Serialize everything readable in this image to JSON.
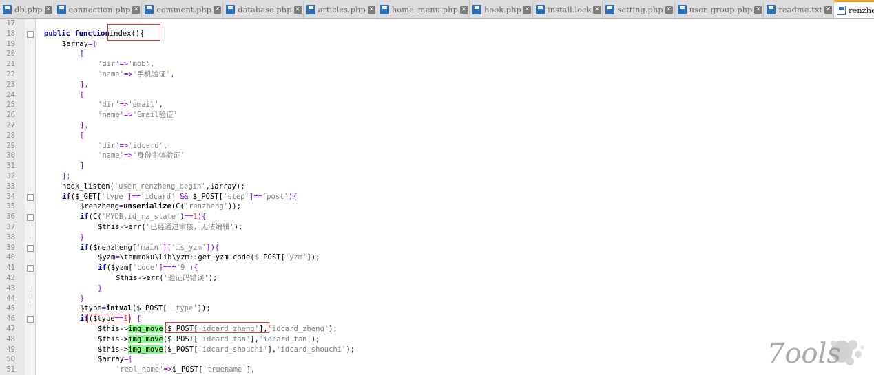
{
  "tabs": [
    {
      "label": "db.php",
      "active": false
    },
    {
      "label": "connection.php",
      "active": false
    },
    {
      "label": "comment.php",
      "active": false
    },
    {
      "label": "database.php",
      "active": false
    },
    {
      "label": "articles.php",
      "active": false
    },
    {
      "label": "home_menu.php",
      "active": false
    },
    {
      "label": "hook.php",
      "active": false
    },
    {
      "label": "install.lock",
      "active": false
    },
    {
      "label": "setting.php",
      "active": false
    },
    {
      "label": "user_group.php",
      "active": false
    },
    {
      "label": "readme.txt",
      "active": false
    },
    {
      "label": "renzheng.p",
      "active": true
    }
  ],
  "editor": {
    "lines": [
      {
        "num": "17",
        "fold": "",
        "indent": 0,
        "tokens": []
      },
      {
        "num": "18",
        "fold": "minus",
        "indent": 0,
        "tokens": [
          [
            "kw",
            "public function"
          ],
          [
            "",
            "index(){"
          ]
        ]
      },
      {
        "num": "19",
        "fold": "line",
        "indent": 1,
        "tokens": [
          [
            "",
            "$array"
          ],
          [
            "op",
            "=["
          ]
        ]
      },
      {
        "num": "20",
        "fold": "line",
        "indent": 2,
        "tokens": [
          [
            "op",
            "["
          ]
        ]
      },
      {
        "num": "21",
        "fold": "line",
        "indent": 3,
        "tokens": [
          [
            "str",
            "'dir'"
          ],
          [
            "op",
            "=>"
          ],
          [
            "str",
            "'mob'"
          ],
          [
            "op",
            ","
          ]
        ]
      },
      {
        "num": "22",
        "fold": "line",
        "indent": 3,
        "tokens": [
          [
            "str",
            "'name'"
          ],
          [
            "op",
            "=>"
          ],
          [
            "str",
            "'手机验证'"
          ],
          [
            "op",
            ","
          ]
        ]
      },
      {
        "num": "23",
        "fold": "line",
        "indent": 2,
        "tokens": [
          [
            "op",
            "],"
          ]
        ]
      },
      {
        "num": "24",
        "fold": "line",
        "indent": 2,
        "tokens": [
          [
            "op",
            "["
          ]
        ]
      },
      {
        "num": "25",
        "fold": "line",
        "indent": 3,
        "tokens": [
          [
            "str",
            "'dir'"
          ],
          [
            "op",
            "=>"
          ],
          [
            "str",
            "'email'"
          ],
          [
            "op",
            ","
          ]
        ]
      },
      {
        "num": "26",
        "fold": "line",
        "indent": 3,
        "tokens": [
          [
            "str",
            "'name'"
          ],
          [
            "op",
            "=>"
          ],
          [
            "str",
            "'Email验证'"
          ]
        ]
      },
      {
        "num": "27",
        "fold": "line",
        "indent": 2,
        "tokens": [
          [
            "op",
            "],"
          ]
        ]
      },
      {
        "num": "28",
        "fold": "line",
        "indent": 2,
        "tokens": [
          [
            "op",
            "["
          ]
        ]
      },
      {
        "num": "29",
        "fold": "line",
        "indent": 3,
        "tokens": [
          [
            "str",
            "'dir'"
          ],
          [
            "op",
            "=>"
          ],
          [
            "str",
            "'idcard'"
          ],
          [
            "op",
            ","
          ]
        ]
      },
      {
        "num": "30",
        "fold": "line",
        "indent": 3,
        "tokens": [
          [
            "str",
            "'name'"
          ],
          [
            "op",
            "=>"
          ],
          [
            "str",
            "'身份主体验证'"
          ]
        ]
      },
      {
        "num": "31",
        "fold": "line",
        "indent": 2,
        "tokens": [
          [
            "op",
            "]"
          ]
        ]
      },
      {
        "num": "32",
        "fold": "line",
        "indent": 1,
        "tokens": [
          [
            "op",
            "];"
          ]
        ]
      },
      {
        "num": "33",
        "fold": "line",
        "indent": 1,
        "tokens": [
          [
            "",
            "hook_listen("
          ],
          [
            "str",
            "'user_renzheng_begin'"
          ],
          [
            "",
            ",$array);"
          ]
        ]
      },
      {
        "num": "34",
        "fold": "minus",
        "indent": 1,
        "tokens": [
          [
            "kw",
            "if"
          ],
          [
            "",
            "($_GET["
          ],
          [
            "str",
            "'type'"
          ],
          [
            "op",
            "]=="
          ],
          [
            "str",
            "'idcard'"
          ],
          [
            "op",
            " && "
          ],
          [
            "",
            "$_POST["
          ],
          [
            "str",
            "'step'"
          ],
          [
            "op",
            "]=="
          ],
          [
            "str",
            "'post'"
          ],
          [
            "op",
            "){"
          ]
        ]
      },
      {
        "num": "35",
        "fold": "line",
        "indent": 2,
        "tokens": [
          [
            "",
            "$renzheng"
          ],
          [
            "op",
            "="
          ],
          [
            "fn",
            "unserialize"
          ],
          [
            "",
            "(C("
          ],
          [
            "str",
            "'renzheng'"
          ],
          [
            "",
            "));"
          ]
        ]
      },
      {
        "num": "36",
        "fold": "minus",
        "indent": 2,
        "tokens": [
          [
            "kw",
            "if"
          ],
          [
            "",
            "(C("
          ],
          [
            "str",
            "'MYDB.id_rz_state'"
          ],
          [
            "",
            ")"
          ],
          [
            "op",
            "=="
          ],
          [
            "num",
            "1"
          ],
          [
            "op",
            "){"
          ]
        ]
      },
      {
        "num": "37",
        "fold": "line",
        "indent": 3,
        "tokens": [
          [
            "",
            "$this->err("
          ],
          [
            "str",
            "'已经通过审核，无法编辑'"
          ],
          [
            "",
            ");"
          ]
        ]
      },
      {
        "num": "38",
        "fold": "end",
        "indent": 2,
        "tokens": [
          [
            "op",
            "}"
          ]
        ]
      },
      {
        "num": "39",
        "fold": "minus",
        "indent": 2,
        "tokens": [
          [
            "kw",
            "if"
          ],
          [
            "",
            "($renzheng["
          ],
          [
            "str",
            "'main'"
          ],
          [
            "op",
            "]["
          ],
          [
            "str",
            "'is_yzm'"
          ],
          [
            "op",
            "]){"
          ]
        ]
      },
      {
        "num": "40",
        "fold": "line",
        "indent": 3,
        "tokens": [
          [
            "",
            "$yzm"
          ],
          [
            "op",
            "="
          ],
          [
            "",
            "\\temmoku\\lib\\yzm::get_yzm_code($_POST["
          ],
          [
            "str",
            "'yzm'"
          ],
          [
            "",
            "]);"
          ]
        ]
      },
      {
        "num": "41",
        "fold": "minus",
        "indent": 3,
        "tokens": [
          [
            "kw",
            "if"
          ],
          [
            "",
            "($yzm["
          ],
          [
            "str",
            "'code'"
          ],
          [
            "op",
            "]==="
          ],
          [
            "str",
            "'9'"
          ],
          [
            "op",
            "){"
          ]
        ]
      },
      {
        "num": "42",
        "fold": "line",
        "indent": 4,
        "tokens": [
          [
            "",
            "$this->err("
          ],
          [
            "str",
            "'验证码错误'"
          ],
          [
            "",
            ");"
          ]
        ]
      },
      {
        "num": "43",
        "fold": "end",
        "indent": 3,
        "tokens": [
          [
            "op",
            "}"
          ]
        ]
      },
      {
        "num": "44",
        "fold": "end",
        "indent": 2,
        "tokens": [
          [
            "op",
            "}"
          ]
        ]
      },
      {
        "num": "45",
        "fold": "line",
        "indent": 2,
        "tokens": [
          [
            "",
            "$type"
          ],
          [
            "op",
            "="
          ],
          [
            "fn",
            "intval"
          ],
          [
            "",
            "($_POST["
          ],
          [
            "str",
            "'_type'"
          ],
          [
            "",
            "]);"
          ]
        ]
      },
      {
        "num": "46",
        "fold": "minus",
        "indent": 2,
        "tokens": [
          [
            "kw",
            "if"
          ],
          [
            "",
            "($type"
          ],
          [
            "op",
            "=="
          ],
          [
            "num",
            "1"
          ],
          [
            "op",
            ") {"
          ]
        ]
      },
      {
        "num": "47",
        "fold": "line",
        "indent": 3,
        "tokens": [
          [
            "",
            "$this->"
          ],
          [
            "hl",
            "img_move"
          ],
          [
            "",
            "($_POST["
          ],
          [
            "str",
            "'idcard_zheng'"
          ],
          [
            "",
            "],"
          ],
          [
            "str",
            "'idcard_zheng'"
          ],
          [
            "",
            ");"
          ]
        ]
      },
      {
        "num": "48",
        "fold": "line",
        "indent": 3,
        "tokens": [
          [
            "",
            "$this->"
          ],
          [
            "hl",
            "img_move"
          ],
          [
            "",
            "($_POST["
          ],
          [
            "str",
            "'idcard_fan'"
          ],
          [
            "",
            "],"
          ],
          [
            "str",
            "'idcard_fan'"
          ],
          [
            "",
            ");"
          ]
        ]
      },
      {
        "num": "49",
        "fold": "line",
        "indent": 3,
        "tokens": [
          [
            "",
            "$this->"
          ],
          [
            "hl",
            "img_move"
          ],
          [
            "",
            "($_POST["
          ],
          [
            "str",
            "'idcard_shouchi'"
          ],
          [
            "",
            "],"
          ],
          [
            "str",
            "'idcard_shouchi'"
          ],
          [
            "",
            ");"
          ]
        ]
      },
      {
        "num": "50",
        "fold": "line",
        "indent": 3,
        "tokens": [
          [
            "",
            "$array"
          ],
          [
            "op",
            "=["
          ]
        ]
      },
      {
        "num": "51",
        "fold": "line",
        "indent": 4,
        "tokens": [
          [
            "str",
            "'real_name'"
          ],
          [
            "op",
            "=>"
          ],
          [
            "",
            "$_POST["
          ],
          [
            "str",
            "'truename'"
          ],
          [
            "",
            "],"
          ]
        ]
      }
    ]
  },
  "watermark": {
    "text": "7ools"
  }
}
